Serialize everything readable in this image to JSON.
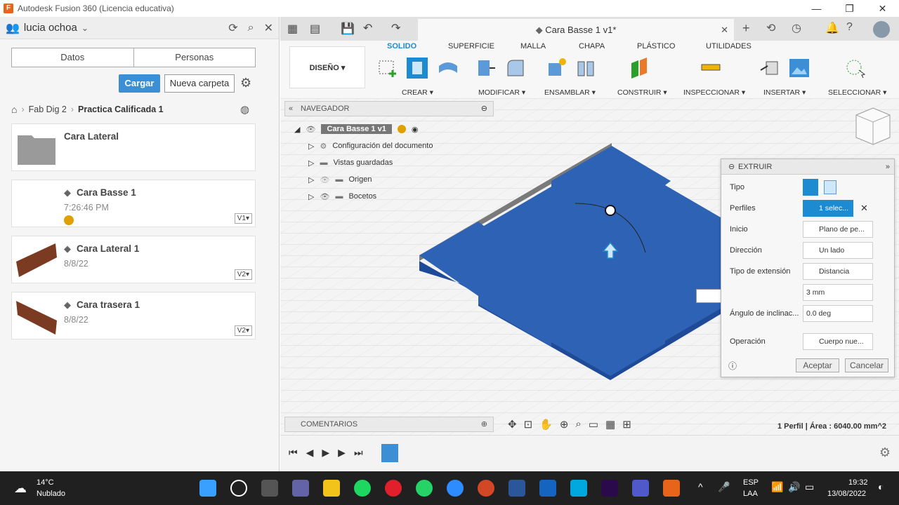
{
  "window": {
    "title": "Autodesk Fusion 360 (Licencia educativa)"
  },
  "data_panel": {
    "user": "lucia ochoa",
    "tabs": [
      {
        "label": "Datos"
      },
      {
        "label": "Personas"
      }
    ],
    "upload_button": "Cargar",
    "new_folder_button": "Nueva carpeta",
    "breadcrumb": [
      "Fab Dig 2",
      "Practica Calificada 1"
    ],
    "items": [
      {
        "name": "Cara Lateral",
        "date": "",
        "version": ""
      },
      {
        "name": "Cara Basse 1",
        "date": "7:26:46 PM",
        "version": "V1▾"
      },
      {
        "name": "Cara Lateral 1",
        "date": "8/8/22",
        "version": "V2▾"
      },
      {
        "name": "Cara trasera 1",
        "date": "8/8/22",
        "version": "V2▾"
      }
    ]
  },
  "document_tab": {
    "title": "Cara Basse 1 v1*"
  },
  "ribbon": {
    "workspace": "DISEÑO ▾",
    "tabs": [
      "SOLIDO",
      "SUPERFICIE",
      "MALLA",
      "CHAPA",
      "PLÁSTICO",
      "UTILIDADES"
    ],
    "groups": [
      "CREAR ▾",
      "MODIFICAR ▾",
      "ENSAMBLAR ▾",
      "CONSTRUIR ▾",
      "INSPECCIONAR ▾",
      "INSERTAR ▾",
      "SELECCIONAR ▾"
    ]
  },
  "browser": {
    "header": "NAVEGADOR",
    "root": "Cara Basse 1 v1",
    "nodes": [
      "Configuración del documento",
      "Vistas guardadas",
      "Origen",
      "Bocetos"
    ]
  },
  "extrude": {
    "title": "EXTRUIR",
    "rows": [
      {
        "label": "Tipo",
        "value": ""
      },
      {
        "label": "Perfiles",
        "value": "1 selec..."
      },
      {
        "label": "Inicio",
        "value": "Plano de pe..."
      },
      {
        "label": "Dirección",
        "value": "Un lado"
      },
      {
        "label": "Tipo de extensión",
        "value": "Distancia"
      },
      {
        "label": "",
        "value": "3 mm"
      },
      {
        "label": "Ángulo de inclinac...",
        "value": "0.0 deg"
      },
      {
        "label": "Operación",
        "value": "Cuerpo nue..."
      }
    ],
    "input_value": "3",
    "ok": "Aceptar",
    "cancel": "Cancelar"
  },
  "comments": "COMENTARIOS",
  "status": "1 Perfil | Área : 6040.00 mm^2",
  "taskbar": {
    "temp": "14°C",
    "weather": "Nublado",
    "lang1": "ESP",
    "lang2": "LAA",
    "time": "19:32",
    "date": "13/08/2022"
  },
  "colors": {
    "accent": "#1d8bd1",
    "model": "#2e62b4"
  }
}
